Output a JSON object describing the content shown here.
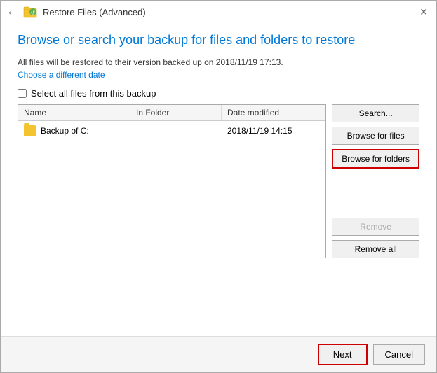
{
  "window": {
    "title": "Restore Files (Advanced)",
    "close_label": "✕"
  },
  "header": {
    "heading": "Browse or search your backup for files and folders to restore",
    "info_text": "All files will be restored to their version backed up on 2018/11/19 17:13.",
    "link_text": "Choose a different date"
  },
  "checkbox": {
    "label": "Select all files from this backup"
  },
  "table": {
    "columns": [
      "Name",
      "In Folder",
      "Date modified"
    ],
    "rows": [
      {
        "name": "Backup of C:",
        "in_folder": "",
        "date_modified": "2018/11/19 14:15",
        "type": "folder"
      }
    ]
  },
  "buttons": {
    "search": "Search...",
    "browse_files": "Browse for files",
    "browse_folders": "Browse for folders",
    "remove": "Remove",
    "remove_all": "Remove all",
    "next": "Next",
    "cancel": "Cancel"
  }
}
